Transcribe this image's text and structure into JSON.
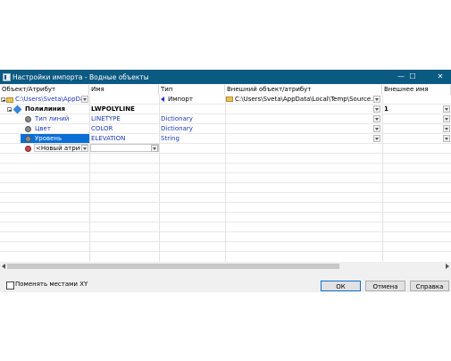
{
  "window": {
    "title": "Настройки импорта - Водные объекты"
  },
  "titlebar": {
    "minimize": "—",
    "maximize": "☐",
    "close": "✕"
  },
  "columns": [
    "Объект/Атрибут",
    "Имя",
    "Тип",
    "Внешний объект/атрибут",
    "Внешнее имя"
  ],
  "rows": [
    {
      "object": "C:\\Users\\Sveta\\AppData\\...",
      "name": "",
      "type": "Импорт",
      "external_object": "C:\\Users\\Sveta\\AppData\\Local\\Temp\\Source.xml",
      "external_name": ""
    },
    {
      "object": "Полилиния",
      "name": "LWPOLYLINE",
      "type": "",
      "external_object": "",
      "external_name": "1"
    },
    {
      "object": "Тип линий",
      "name": "LINETYPE",
      "type": "Dictionary",
      "external_object": "",
      "external_name": ""
    },
    {
      "object": "Цвет",
      "name": "COLOR",
      "type": "Dictionary",
      "external_object": "",
      "external_name": ""
    },
    {
      "object": "Уровень",
      "name": "ELEVATION",
      "type": "String",
      "external_object": "",
      "external_name": ""
    },
    {
      "object": "<Новый атрибут>",
      "name": "",
      "type": "",
      "external_object": "",
      "external_name": ""
    }
  ],
  "options": {
    "swap_xy_label": "Поменять местами XY",
    "swap_xy_checked": false
  },
  "buttons": {
    "ok": "ОК",
    "cancel": "Отмена",
    "help": "Справка"
  },
  "icons": {
    "folder": "folder-icon",
    "polyline": "polyline-icon",
    "attribute": "attribute-icon",
    "new_attribute": "new-attribute-icon",
    "import": "import-arrow-icon"
  },
  "colors": {
    "titlebar": "#0b5a82",
    "selection": "#0a6fd6",
    "attribute_text": "#1d38b8"
  }
}
